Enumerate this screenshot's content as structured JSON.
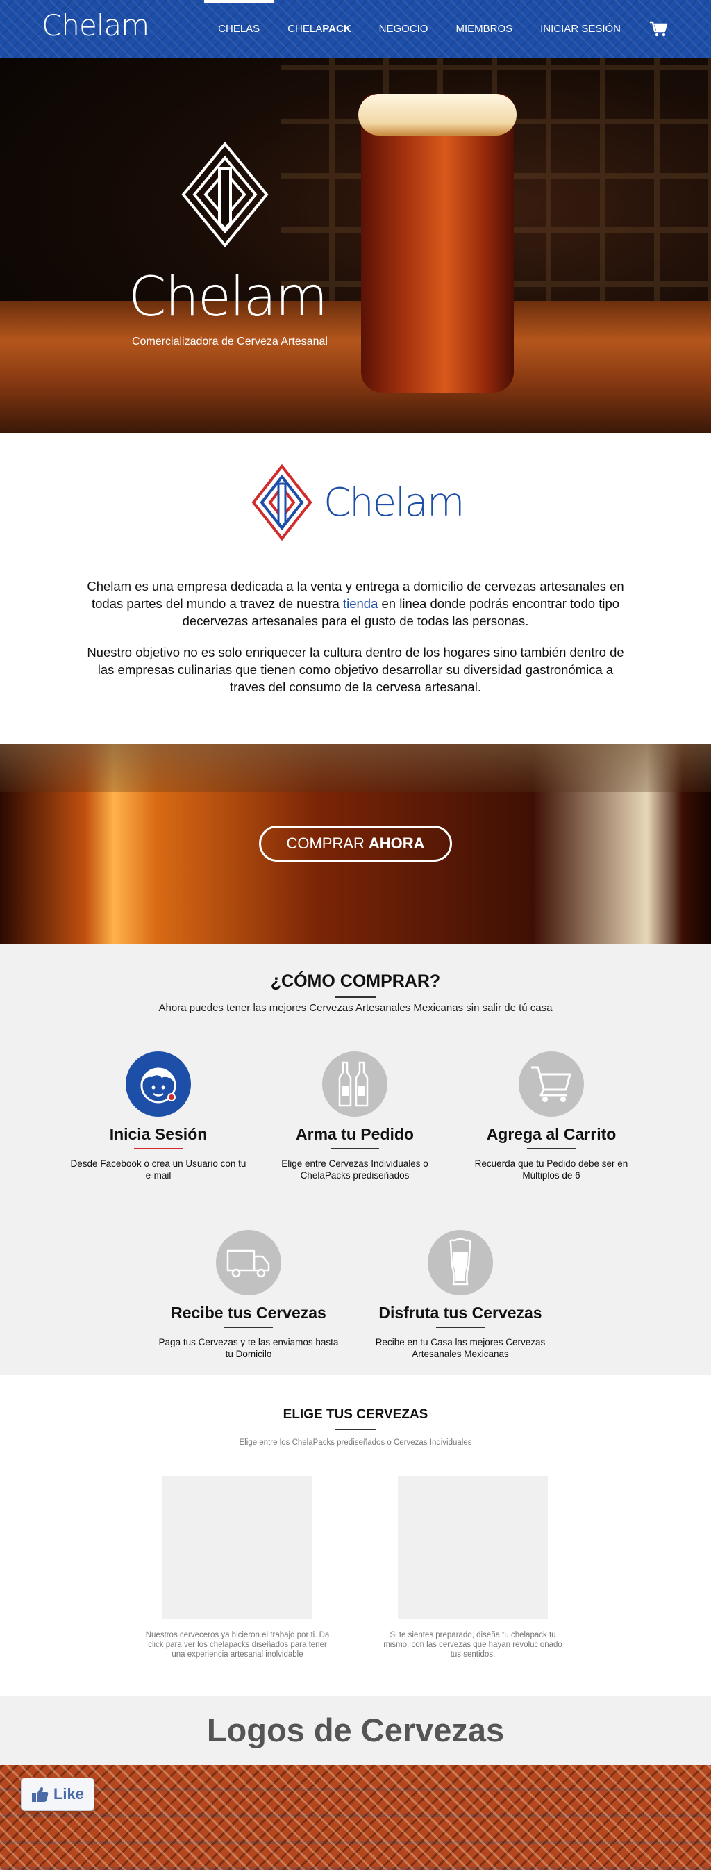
{
  "nav": {
    "brand": "Chelam",
    "links": [
      {
        "label": "CHELAS"
      },
      {
        "label_plain": "CHELA",
        "label_bold": "PACK"
      },
      {
        "label": "NEGOCIO"
      },
      {
        "label": "MIEMBROS"
      },
      {
        "label": "INICIAR SESIÓN"
      }
    ],
    "cart_icon": "shopping-cart-icon"
  },
  "hero": {
    "title": "Chelam",
    "subtitle": "Comercializadora de Cerveza Artesanal"
  },
  "about": {
    "logo_word": "Chelam",
    "p1_before": "Chelam es una empresa dedicada a la venta y entrega a domicilio de cervezas artesanales en todas partes del mundo a travez de nuestra ",
    "p1_link": "tienda",
    "p1_after": " en linea donde podrás encontrar todo tipo decervezas artesanales para el gusto de todas las personas.",
    "p2": "Nuestro objetivo no es solo enriquecer la cultura dentro de los hogares sino también dentro de las empresas culinarias que tienen como objetivo desarrollar su diversidad gastronómica a traves del consumo de la cervesa artesanal."
  },
  "buy": {
    "label_plain": "COMPRAR",
    "label_bold": "AHORA"
  },
  "how": {
    "title": "¿CÓMO COMPRAR?",
    "subtitle": "Ahora puedes tener las mejores Cervezas Artesanales Mexicanas sin salir de tú casa",
    "steps": [
      {
        "title": "Inicia Sesión",
        "desc": "Desde Facebook o crea un Usuario con tu e-mail",
        "icon": "user-face-icon"
      },
      {
        "title": "Arma tu Pedido",
        "desc": "Elige entre Cervezas Individuales o ChelaPacks prediseñados",
        "icon": "beer-bottles-icon"
      },
      {
        "title": "Agrega al Carrito",
        "desc": "Recuerda que tu Pedido debe ser en Múltiplos de 6",
        "icon": "cart-icon"
      },
      {
        "title": "Recibe tus Cervezas",
        "desc": "Paga tus Cervezas y te las enviamos hasta tu Domicilo",
        "icon": "truck-icon"
      },
      {
        "title": "Disfruta tus Cervezas",
        "desc": "Recibe en tu Casa las mejores Cervezas Artesanales Mexicanas",
        "icon": "beer-glass-icon"
      }
    ]
  },
  "choose": {
    "title": "ELIGE TUS CERVEZAS",
    "subtitle": "Elige entre los ChelaPacks prediseñados o Cervezas Individuales",
    "left_desc": "Nuestros cerveceros ya hicieron el trabajo por ti. Da click para ver los chelapacks diseñados para tener una experiencia artesanal inolvidable",
    "right_desc": "Si te sientes preparado, diseña tu chelapack tu mismo, con las cervezas que hayan revolucionado tus sentidos."
  },
  "logos": {
    "title": "Logos de Cervezas"
  },
  "like": {
    "label": "Like"
  },
  "colors": {
    "brand_blue": "#1d4ea8",
    "accent_red": "#d12c2c",
    "section_gray": "#f1f1f1"
  }
}
